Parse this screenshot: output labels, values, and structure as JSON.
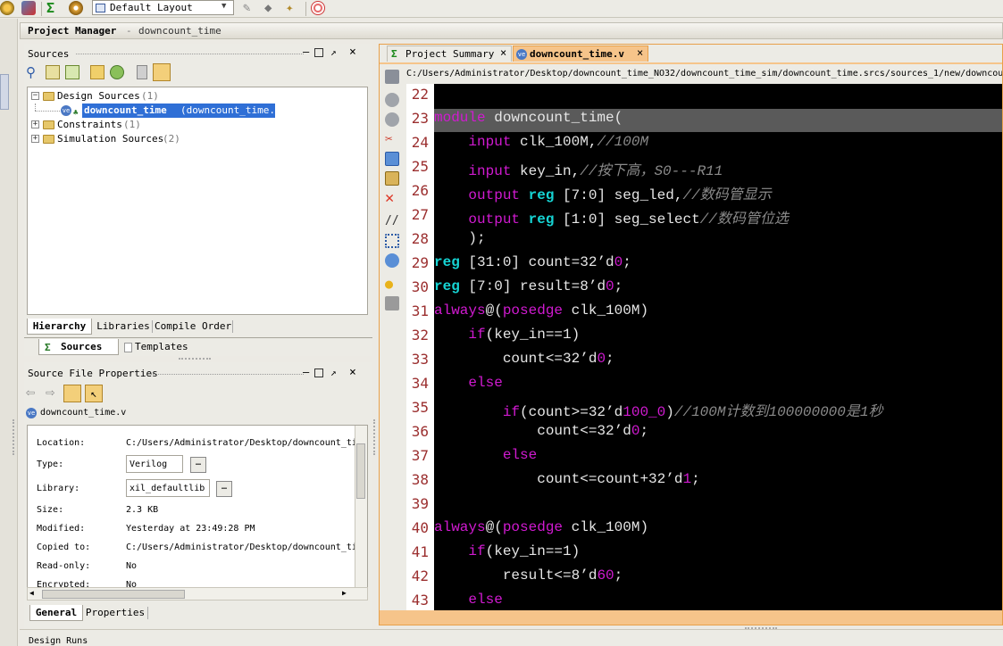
{
  "toolbar": {
    "layout_label": "Default Layout"
  },
  "pm_header": {
    "title": "Project Manager",
    "project": "downcount_time"
  },
  "sources_panel": {
    "title": "Sources",
    "tree": [
      {
        "label": "Design Sources",
        "count": "(1)"
      },
      {
        "label": "downcount_time",
        "file": "(downcount_time.v)"
      },
      {
        "label": "Constraints",
        "count": "(1)"
      },
      {
        "label": "Simulation Sources",
        "count": "(2)"
      }
    ],
    "tabs": [
      "Hierarchy",
      "Libraries",
      "Compile Order"
    ],
    "bottom_tabs": [
      "Sources",
      "Templates"
    ]
  },
  "props_panel": {
    "title": "Source File Properties",
    "file": "downcount_time.v",
    "rows": [
      {
        "k": "Location:",
        "v": "C:/Users/Administrator/Desktop/downcount_ti"
      },
      {
        "k": "Type:",
        "v": "Verilog"
      },
      {
        "k": "Library:",
        "v": "xil_defaultlib"
      },
      {
        "k": "Size:",
        "v": "2.3 KB"
      },
      {
        "k": "Modified:",
        "v": "Yesterday at 23:49:28 PM"
      },
      {
        "k": "Copied to:",
        "v": "C:/Users/Administrator/Desktop/downcount_ti"
      },
      {
        "k": "Read-only:",
        "v": "No"
      },
      {
        "k": "Encrypted:",
        "v": "No"
      }
    ],
    "tabs": [
      "General",
      "Properties"
    ]
  },
  "editor": {
    "tabs": [
      "Project Summary",
      "downcount_time.v"
    ],
    "path": "C:/Users/Administrator/Desktop/downcount_time_NO32/downcount_time_sim/downcount_time.srcs/sources_1/new/downcou",
    "line_numbers": [
      "22",
      "23",
      "24",
      "25",
      "26",
      "27",
      "28",
      "29",
      "30",
      "31",
      "32",
      "33",
      "34",
      "35",
      "36",
      "37",
      "38",
      "39",
      "40",
      "41",
      "42",
      "43"
    ]
  },
  "bottom_bar": {
    "label": "Design Runs"
  },
  "colors": {
    "editor_bg": "#000000",
    "keyword": "#d11ad1",
    "type": "#16d4d4",
    "comment": "#8a8a8a",
    "line_number": "#9b2f2f",
    "selection": "#2f6fd6"
  }
}
